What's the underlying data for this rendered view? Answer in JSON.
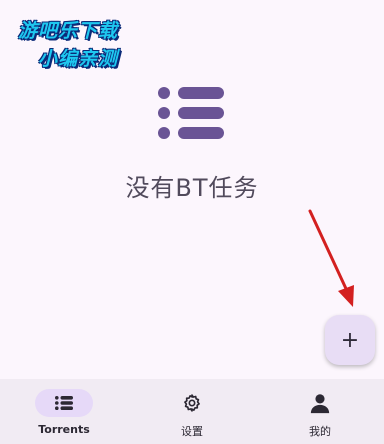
{
  "watermark": {
    "line1": "游吧乐下载",
    "line2": "小编亲测"
  },
  "empty_state": {
    "icon": "list-icon",
    "message": "没有BT任务"
  },
  "fab": {
    "icon": "plus-icon",
    "label": "+"
  },
  "bottom_nav": {
    "items": [
      {
        "label": "Torrents",
        "icon": "list-icon",
        "active": true
      },
      {
        "label": "设置",
        "icon": "gear-icon",
        "active": false
      },
      {
        "label": "我的",
        "icon": "person-icon",
        "active": false
      }
    ]
  },
  "colors": {
    "background": "#fcf6fd",
    "accent": "#6a5495",
    "fab_bg": "#e8ddf5",
    "nav_bg": "#f1ebf3",
    "nav_active_pill": "#e6d9f8",
    "annotation_arrow": "#d32020"
  }
}
